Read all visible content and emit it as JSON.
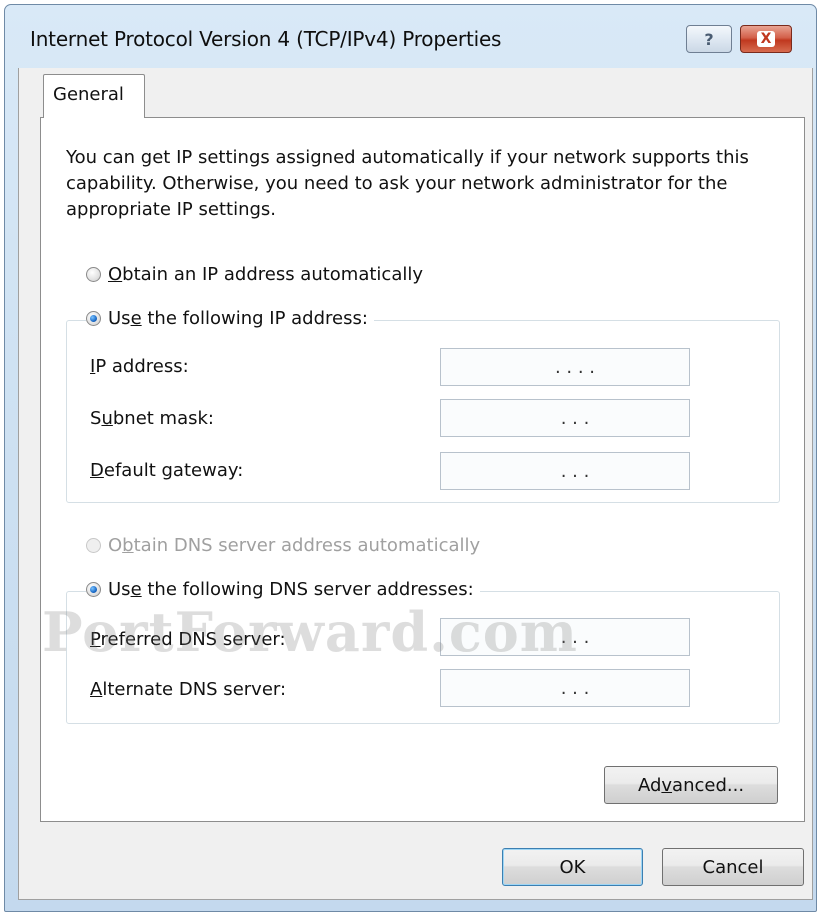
{
  "window": {
    "title": "Internet Protocol Version 4 (TCP/IPv4) Properties",
    "help_label": "?",
    "close_label": "X"
  },
  "tabs": [
    {
      "label": "General"
    }
  ],
  "intro_text": "You can get IP settings assigned automatically if your network supports this capability. Otherwise, you need to ask your network administrator for the appropriate IP settings.",
  "ip_section": {
    "obtain_auto": {
      "pre": "",
      "accel": "O",
      "post": "btain an IP address automatically",
      "checked": false
    },
    "use_following": {
      "pre": "Us",
      "accel": "e",
      "post": " the following IP address:",
      "checked": true
    },
    "fields": [
      {
        "pre": "",
        "accel": "I",
        "post": "P address:",
        "value": ". . . ."
      },
      {
        "pre": "S",
        "accel": "u",
        "post": "bnet mask:",
        "value": ". . ."
      },
      {
        "pre": "",
        "accel": "D",
        "post": "efault gateway:",
        "value": ". . ."
      }
    ]
  },
  "dns_section": {
    "obtain_auto": {
      "pre": "O",
      "accel": "b",
      "post": "tain DNS server address automatically",
      "checked": false,
      "disabled": true
    },
    "use_following": {
      "pre": "Us",
      "accel": "e",
      "post": " the following DNS server addresses:",
      "checked": true
    },
    "fields": [
      {
        "pre": "",
        "accel": "P",
        "post": "referred DNS server:",
        "value": ". . ."
      },
      {
        "pre": "",
        "accel": "A",
        "post": "lternate DNS server:",
        "value": ". . ."
      }
    ]
  },
  "buttons": {
    "advanced": {
      "pre": "Ad",
      "accel": "v",
      "post": "anced..."
    },
    "ok": "OK",
    "cancel": "Cancel"
  },
  "watermark": "PortForward.com"
}
